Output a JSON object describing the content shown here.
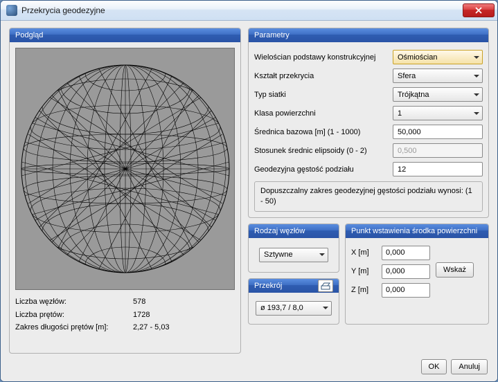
{
  "window": {
    "title": "Przekrycia geodezyjne"
  },
  "preview": {
    "header": "Podgląd",
    "stats": {
      "nodes_label": "Liczba węzłów:",
      "nodes_value": "578",
      "bars_label": "Liczba prętów:",
      "bars_value": "1728",
      "range_label": "Zakres długości prętów [m]:",
      "range_value": "2,27 - 5,03"
    }
  },
  "params": {
    "header": "Parametry",
    "rows": {
      "polyhedron": {
        "label": "Wielościan podstawy konstrukcyjnej",
        "value": "Ośmiościan"
      },
      "shape": {
        "label": "Kształt przekrycia",
        "value": "Sfera"
      },
      "mesh": {
        "label": "Typ siatki",
        "value": "Trójkątna"
      },
      "class": {
        "label": "Klasa powierzchni",
        "value": "1"
      },
      "diameter": {
        "label": "Średnica bazowa [m] (1 - 1000)",
        "value": "50,000"
      },
      "ratio": {
        "label": "Stosunek średnic elipsoidy (0 - 2)",
        "value": "0,500"
      },
      "density": {
        "label": "Geodezyjna gęstość podziału",
        "value": "12"
      }
    },
    "note": "Dopuszczalny zakres geodezyjnej gęstości podziału wynosi: (1 - 50)"
  },
  "nodes": {
    "header": "Rodzaj węzłów",
    "value": "Sztywne"
  },
  "section": {
    "header": "Przekrój",
    "value": "ø 193,7 / 8,0"
  },
  "point": {
    "header": "Punkt wstawienia środka powierzchni",
    "x_label": "X [m]",
    "x_value": "0,000",
    "y_label": "Y [m]",
    "y_value": "0,000",
    "z_label": "Z [m]",
    "z_value": "0,000",
    "pick_label": "Wskaż"
  },
  "footer": {
    "ok": "OK",
    "cancel": "Anuluj"
  }
}
